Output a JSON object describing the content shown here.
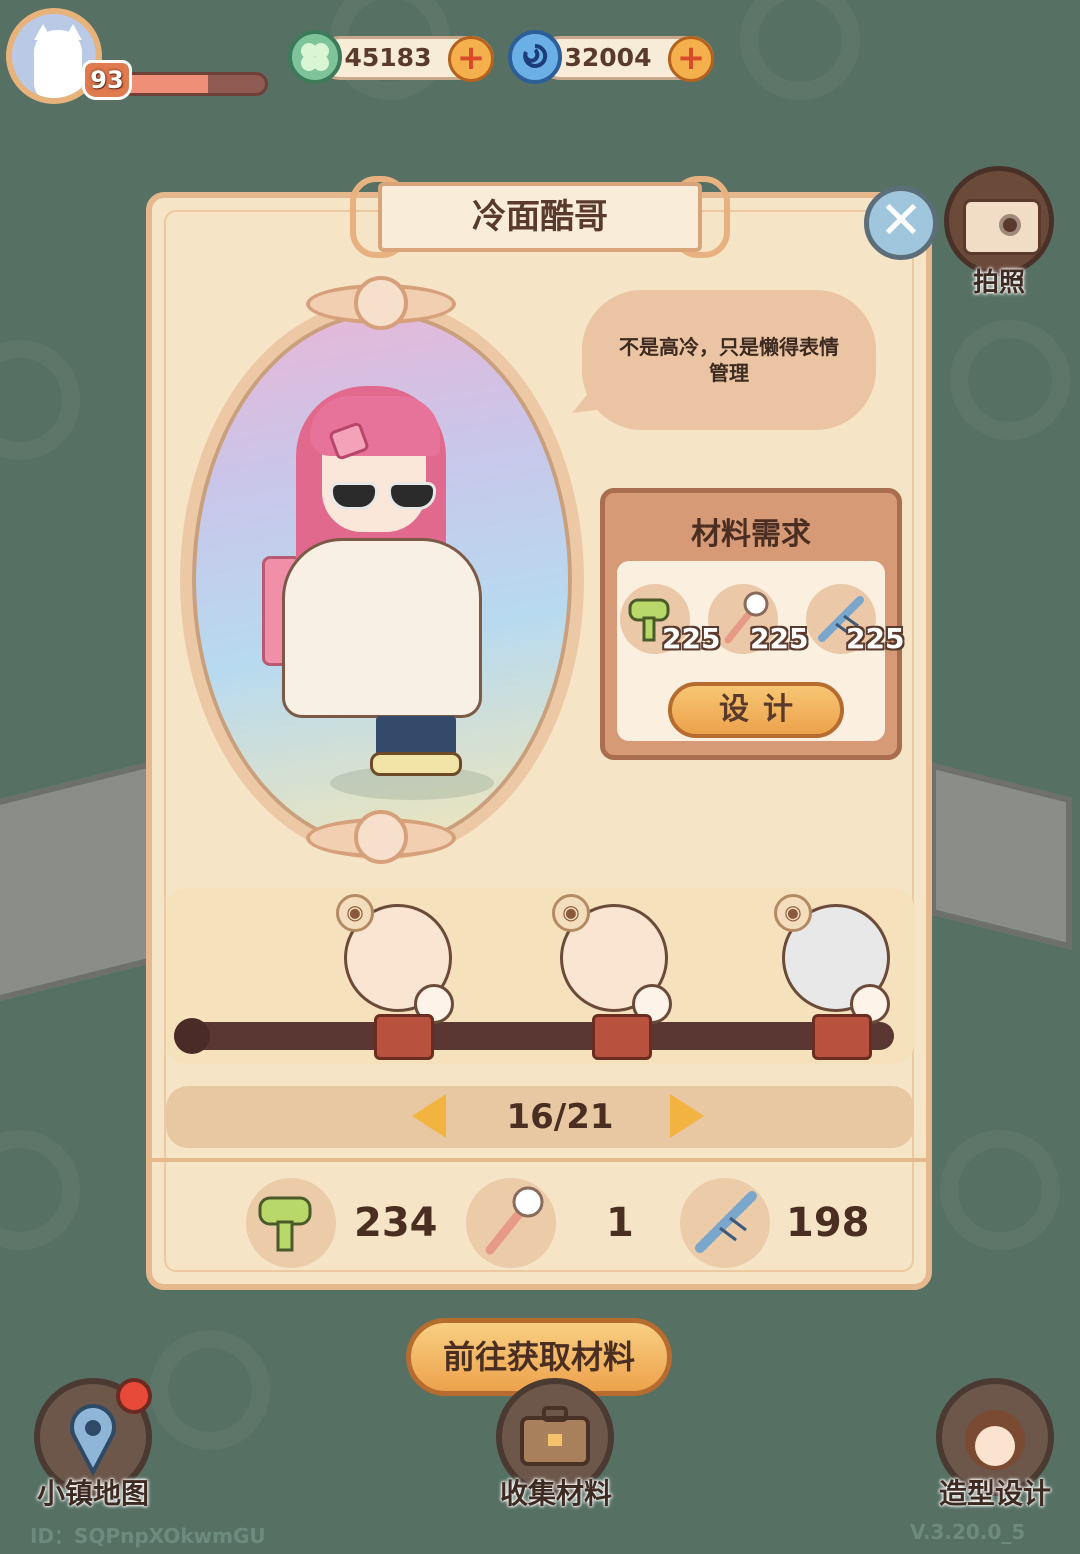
{
  "hud": {
    "level": "93",
    "level_progress": 0.6,
    "currencies": [
      {
        "icon": "clover-coin-icon",
        "value": "45183"
      },
      {
        "icon": "swirl-gem-icon",
        "value": "32004"
      }
    ]
  },
  "camera": {
    "label": "拍照",
    "icon": "camera-icon"
  },
  "panel": {
    "title": "冷面酷哥",
    "speech": "不是高冷，只是懒得表情管理",
    "materials": {
      "title": "材料需求",
      "items": [
        {
          "icon": "hair-dryer-icon",
          "count": "225"
        },
        {
          "icon": "makeup-brush-icon",
          "count": "225"
        },
        {
          "icon": "comb-icon",
          "count": "225"
        }
      ],
      "design_button": "设计"
    },
    "pager": "16/21",
    "inventory": [
      {
        "icon": "hair-dryer-icon",
        "count": "234"
      },
      {
        "icon": "makeup-brush-icon",
        "count": "1"
      },
      {
        "icon": "comb-icon",
        "count": "198"
      }
    ]
  },
  "go_button": "前往获取材料",
  "nav": [
    {
      "label": "小镇地图",
      "icon": "map-pin-icon"
    },
    {
      "label": "收集材料",
      "icon": "suitcase-icon"
    },
    {
      "label": "造型设计",
      "icon": "stylist-avatar-icon"
    }
  ],
  "footer": {
    "id": "ID：SQPnpXOkwmGU",
    "version": "V.3.20.0_5"
  },
  "colors": {
    "background": "#577064",
    "panel": "#f6e4c6",
    "accent": "#eda24c"
  }
}
